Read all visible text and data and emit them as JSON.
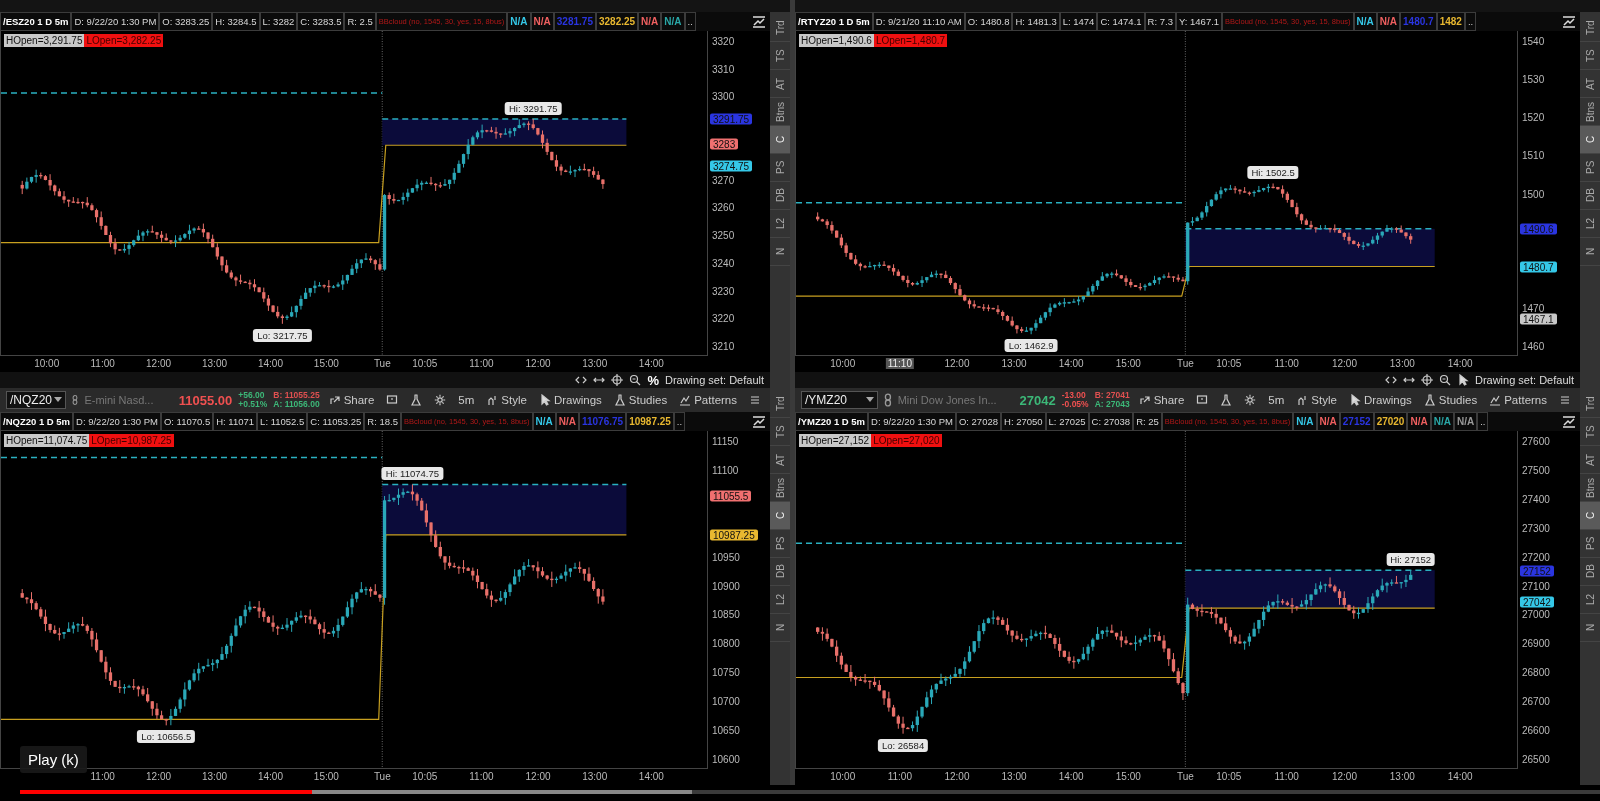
{
  "panels": [
    {
      "header": [
        {
          "text": "/ESZ20 1 D 5m",
          "kind": "title"
        },
        {
          "text": "D: 9/22/20 1:30 PM",
          "kind": "field"
        },
        {
          "text": "O: 3283.25",
          "kind": "field"
        },
        {
          "text": "H: 3284.5",
          "kind": "field"
        },
        {
          "text": "L: 3282",
          "kind": "field"
        },
        {
          "text": "C: 3283.5",
          "kind": "field"
        },
        {
          "text": "R: 2.5",
          "kind": "field"
        },
        {
          "text": "BBcloud (no, 1545, 30, yes, 15, 8bus)",
          "kind": "study"
        },
        {
          "text": "N/A",
          "kind": "value",
          "color": "#35c8e8"
        },
        {
          "text": "N/A",
          "kind": "value",
          "color": "#f06060"
        },
        {
          "text": "3281.75",
          "kind": "value",
          "color": "#2a35e0"
        },
        {
          "text": "3282.25",
          "kind": "value",
          "color": "#e8b830"
        },
        {
          "text": "N/A",
          "kind": "value",
          "color": "#f06060"
        },
        {
          "text": "N/A",
          "kind": "value",
          "color": "#2aa8a8"
        },
        {
          "text": "..",
          "kind": "more"
        }
      ],
      "hopen": "HOpen=3,291.75",
      "lopen": "LOpen=3,282.25",
      "hi_label": "Hi: 3291.75",
      "lo_label": "Lo: 3217.75",
      "yticks": [
        "3320",
        "3310",
        "3300",
        "3270",
        "3260",
        "3250",
        "3240",
        "3230",
        "3220",
        "3210"
      ],
      "badges": [
        {
          "text": "3291.75",
          "color": "#2a35e0"
        },
        {
          "text": "3283",
          "color": "#f07070"
        },
        {
          "text": "3274.75",
          "color": "#35c8e8"
        }
      ],
      "xticks": [
        {
          "text": "10:00",
          "kind": "time"
        },
        {
          "text": "11:00",
          "kind": "time"
        },
        {
          "text": "12:00",
          "kind": "time"
        },
        {
          "text": "13:00",
          "kind": "time"
        },
        {
          "text": "14:00",
          "kind": "time"
        },
        {
          "text": "15:00",
          "kind": "time"
        },
        {
          "text": "Tue",
          "kind": "day"
        },
        {
          "text": "10:05",
          "kind": "time"
        },
        {
          "text": "11:00",
          "kind": "time"
        },
        {
          "text": "12:00",
          "kind": "time"
        },
        {
          "text": "13:00",
          "kind": "time"
        },
        {
          "text": "14:00",
          "kind": "time"
        }
      ],
      "side_tabs": [
        {
          "label": "Trd",
          "selected": false
        },
        {
          "label": "TS",
          "selected": false
        },
        {
          "label": "AT",
          "selected": false
        },
        {
          "label": "Btns",
          "selected": false
        },
        {
          "label": "C",
          "selected": true
        },
        {
          "label": "PS",
          "selected": false
        },
        {
          "label": "DB",
          "selected": false
        },
        {
          "label": "L2",
          "selected": false
        },
        {
          "label": "N",
          "selected": false
        }
      ],
      "footer": {
        "tools": [
          {
            "kind": "scroll"
          },
          {
            "kind": "pan"
          },
          {
            "kind": "crosshair"
          },
          {
            "kind": "zoom"
          },
          {
            "kind": "text",
            "text": "%"
          }
        ],
        "text": "Drawing set: Default"
      }
    },
    {
      "header": [
        {
          "text": "/RTYZ20 1 D 5m",
          "kind": "title"
        },
        {
          "text": "D: 9/21/20 11:10 AM",
          "kind": "field"
        },
        {
          "text": "O: 1480.8",
          "kind": "field"
        },
        {
          "text": "H: 1481.3",
          "kind": "field"
        },
        {
          "text": "L: 1474",
          "kind": "field"
        },
        {
          "text": "C: 1474.1",
          "kind": "field"
        },
        {
          "text": "R: 7.3",
          "kind": "field"
        },
        {
          "text": "Y: 1467.1",
          "kind": "field"
        },
        {
          "text": "BBcloud (no, 1545, 30, yes, 15, 8bus)",
          "kind": "study"
        },
        {
          "text": "N/A",
          "kind": "value",
          "color": "#35c8e8"
        },
        {
          "text": "N/A",
          "kind": "value",
          "color": "#f06060"
        },
        {
          "text": "1480.7",
          "kind": "value",
          "color": "#2a35e0"
        },
        {
          "text": "1482",
          "kind": "value",
          "color": "#e8b830"
        },
        {
          "text": "..",
          "kind": "more"
        }
      ],
      "hopen": "HOpen=1,490.6",
      "lopen": "LOpen=1,480.7",
      "hi_label": "Hi: 1502.5",
      "lo_label": "Lo: 1462.9",
      "yticks": [
        "1540",
        "1530",
        "1520",
        "1510",
        "1500",
        "1470",
        "1460"
      ],
      "badges": [
        {
          "text": "1490.6",
          "color": "#2a35e0"
        },
        {
          "text": "1480.7",
          "color": "#35c8e8"
        },
        {
          "text": "1467.1",
          "color": "#c8c8c8"
        }
      ],
      "xticks": [
        {
          "text": "10:00",
          "kind": "time"
        },
        {
          "text": "11:10",
          "kind": "cursor"
        },
        {
          "text": "12:00",
          "kind": "time"
        },
        {
          "text": "13:00",
          "kind": "time"
        },
        {
          "text": "14:00",
          "kind": "time"
        },
        {
          "text": "15:00",
          "kind": "time"
        },
        {
          "text": "Tue",
          "kind": "day"
        },
        {
          "text": "10:05",
          "kind": "time"
        },
        {
          "text": "11:00",
          "kind": "time"
        },
        {
          "text": "12:00",
          "kind": "time"
        },
        {
          "text": "13:00",
          "kind": "time"
        },
        {
          "text": "14:00",
          "kind": "time"
        }
      ],
      "side_tabs": [
        {
          "label": "Trd",
          "selected": false
        },
        {
          "label": "TS",
          "selected": false
        },
        {
          "label": "AT",
          "selected": false
        },
        {
          "label": "Btns",
          "selected": false
        },
        {
          "label": "C",
          "selected": true
        },
        {
          "label": "PS",
          "selected": false
        },
        {
          "label": "DB",
          "selected": false
        },
        {
          "label": "L2",
          "selected": false
        },
        {
          "label": "N",
          "selected": false
        }
      ],
      "footer": {
        "tools": [
          {
            "kind": "scroll"
          },
          {
            "kind": "pan"
          },
          {
            "kind": "crosshair"
          },
          {
            "kind": "zoom"
          },
          {
            "kind": "cursor"
          }
        ],
        "text": "Drawing set: Default"
      }
    },
    {
      "toolbar": {
        "symbol": "/NQZ20",
        "description": "E-mini Nasd...",
        "price": {
          "text": "11055.00",
          "color": "#f05050"
        },
        "change": {
          "lines": [
            "+56.00",
            "+0.51%"
          ],
          "color": "#3cb878"
        },
        "bid": "B: 11055.25",
        "ask": "A: 11056.00",
        "buttons": [
          {
            "kind": "share",
            "label": "Share"
          },
          {
            "kind": "alert"
          },
          {
            "kind": "flask"
          },
          {
            "kind": "gear"
          },
          {
            "kind": "text",
            "label": "5m"
          },
          {
            "kind": "style",
            "label": "Style"
          },
          {
            "kind": "cursor",
            "label": "Drawings"
          },
          {
            "kind": "flask",
            "label": "Studies"
          },
          {
            "kind": "patterns",
            "label": "Patterns"
          },
          {
            "kind": "menu"
          }
        ]
      },
      "header": [
        {
          "text": "/NQZ20 1 D 5m",
          "kind": "title"
        },
        {
          "text": "D: 9/22/20 1:30 PM",
          "kind": "field"
        },
        {
          "text": "O: 11070.5",
          "kind": "field"
        },
        {
          "text": "H: 11071",
          "kind": "field"
        },
        {
          "text": "L: 11052.5",
          "kind": "field"
        },
        {
          "text": "C: 11053.25",
          "kind": "field"
        },
        {
          "text": "R: 18.5",
          "kind": "field"
        },
        {
          "text": "BBcloud (no, 1545, 30, yes, 15, 8bus)",
          "kind": "study"
        },
        {
          "text": "N/A",
          "kind": "value",
          "color": "#35c8e8"
        },
        {
          "text": "N/A",
          "kind": "value",
          "color": "#f06060"
        },
        {
          "text": "11076.75",
          "kind": "value",
          "color": "#2a35e0"
        },
        {
          "text": "10987.25",
          "kind": "value",
          "color": "#e8b830"
        },
        {
          "text": "..",
          "kind": "more"
        }
      ],
      "hopen": "HOpen=11,074.75",
      "lopen": "LOpen=10,987.25",
      "hi_label": "Hi: 11074.75",
      "lo_label": "Lo: 10656.5",
      "yticks": [
        "11150",
        "11100",
        "10950",
        "10900",
        "10850",
        "10800",
        "10750",
        "10700",
        "10650",
        "10600"
      ],
      "badges": [
        {
          "text": "11055.5",
          "color": "#f07070"
        },
        {
          "text": "10987.25",
          "color": "#e8b830"
        }
      ],
      "xticks": [
        {
          "text": "11:00",
          "kind": "time"
        },
        {
          "text": "12:00",
          "kind": "time"
        },
        {
          "text": "13:00",
          "kind": "time"
        },
        {
          "text": "14:00",
          "kind": "time"
        },
        {
          "text": "15:00",
          "kind": "time"
        },
        {
          "text": "Tue",
          "kind": "day"
        },
        {
          "text": "10:05",
          "kind": "time"
        },
        {
          "text": "11:00",
          "kind": "time"
        },
        {
          "text": "12:00",
          "kind": "time"
        },
        {
          "text": "13:00",
          "kind": "time"
        },
        {
          "text": "14:00",
          "kind": "time"
        }
      ],
      "side_tabs": [
        {
          "label": "Trd",
          "selected": false
        },
        {
          "label": "TS",
          "selected": false
        },
        {
          "label": "AT",
          "selected": false
        },
        {
          "label": "Btns",
          "selected": false
        },
        {
          "label": "C",
          "selected": true
        },
        {
          "label": "PS",
          "selected": false
        },
        {
          "label": "DB",
          "selected": false
        },
        {
          "label": "L2",
          "selected": false
        },
        {
          "label": "N",
          "selected": false
        }
      ]
    },
    {
      "toolbar": {
        "symbol": "/YMZ20",
        "description": "Mini Dow Jones In...",
        "price": {
          "text": "27042",
          "color": "#3cb878"
        },
        "change": {
          "lines": [
            "-13.00",
            "-0.05%"
          ],
          "color": "#f05050"
        },
        "bid": "B: 27041",
        "ask": "A: 27043",
        "buttons": [
          {
            "kind": "share",
            "label": "Share"
          },
          {
            "kind": "alert"
          },
          {
            "kind": "flask"
          },
          {
            "kind": "gear"
          },
          {
            "kind": "text",
            "label": "5m"
          },
          {
            "kind": "style",
            "label": "Style"
          },
          {
            "kind": "cursor",
            "label": "Drawings"
          },
          {
            "kind": "flask",
            "label": "Studies"
          },
          {
            "kind": "patterns",
            "label": "Patterns"
          },
          {
            "kind": "menu"
          }
        ]
      },
      "header": [
        {
          "text": "/YMZ20 1 D 5m",
          "kind": "title"
        },
        {
          "text": "D: 9/22/20 1:30 PM",
          "kind": "field"
        },
        {
          "text": "O: 27028",
          "kind": "field"
        },
        {
          "text": "H: 27050",
          "kind": "field"
        },
        {
          "text": "L: 27025",
          "kind": "field"
        },
        {
          "text": "C: 27038",
          "kind": "field"
        },
        {
          "text": "R: 25",
          "kind": "field"
        },
        {
          "text": "BBcloud (no, 1545, 30, yes, 15, 8bus)",
          "kind": "study"
        },
        {
          "text": "N/A",
          "kind": "value",
          "color": "#35c8e8"
        },
        {
          "text": "N/A",
          "kind": "value",
          "color": "#f06060"
        },
        {
          "text": "27152",
          "kind": "value",
          "color": "#2a35e0"
        },
        {
          "text": "27020",
          "kind": "value",
          "color": "#e8b830"
        },
        {
          "text": "N/A",
          "kind": "value",
          "color": "#f06060"
        },
        {
          "text": "N/A",
          "kind": "value",
          "color": "#2aa8a8"
        },
        {
          "text": "N/A",
          "kind": "value",
          "color": "#9a9a9a"
        },
        {
          "text": "..",
          "kind": "more"
        }
      ],
      "hopen": "HOpen=27,152",
      "lopen": "LOpen=27,020",
      "hi_label": "Hi: 27152",
      "lo_label": "Lo: 26584",
      "yticks": [
        "27600",
        "27500",
        "27400",
        "27300",
        "27200",
        "27100",
        "27000",
        "26900",
        "26800",
        "26700",
        "26600",
        "26500"
      ],
      "badges": [
        {
          "text": "27152",
          "color": "#2a35e0"
        },
        {
          "text": "27042",
          "color": "#35c8e8"
        }
      ],
      "xticks": [
        {
          "text": "10:00",
          "kind": "time"
        },
        {
          "text": "11:00",
          "kind": "time"
        },
        {
          "text": "12:00",
          "kind": "time"
        },
        {
          "text": "13:00",
          "kind": "time"
        },
        {
          "text": "14:00",
          "kind": "time"
        },
        {
          "text": "15:00",
          "kind": "time"
        },
        {
          "text": "Tue",
          "kind": "day"
        },
        {
          "text": "10:05",
          "kind": "time"
        },
        {
          "text": "11:00",
          "kind": "time"
        },
        {
          "text": "12:00",
          "kind": "time"
        },
        {
          "text": "13:00",
          "kind": "time"
        },
        {
          "text": "14:00",
          "kind": "time"
        }
      ],
      "side_tabs": [
        {
          "label": "Trd",
          "selected": false
        },
        {
          "label": "TS",
          "selected": false
        },
        {
          "label": "AT",
          "selected": false
        },
        {
          "label": "Btns",
          "selected": false
        },
        {
          "label": "C",
          "selected": true
        },
        {
          "label": "PS",
          "selected": false
        },
        {
          "label": "DB",
          "selected": false
        },
        {
          "label": "L2",
          "selected": false
        },
        {
          "label": "N",
          "selected": false
        }
      ]
    }
  ],
  "video": {
    "tooltip": "Play (k)",
    "progress": {
      "level": 0.185
    },
    "buffered": {
      "level": 0.425
    }
  }
}
